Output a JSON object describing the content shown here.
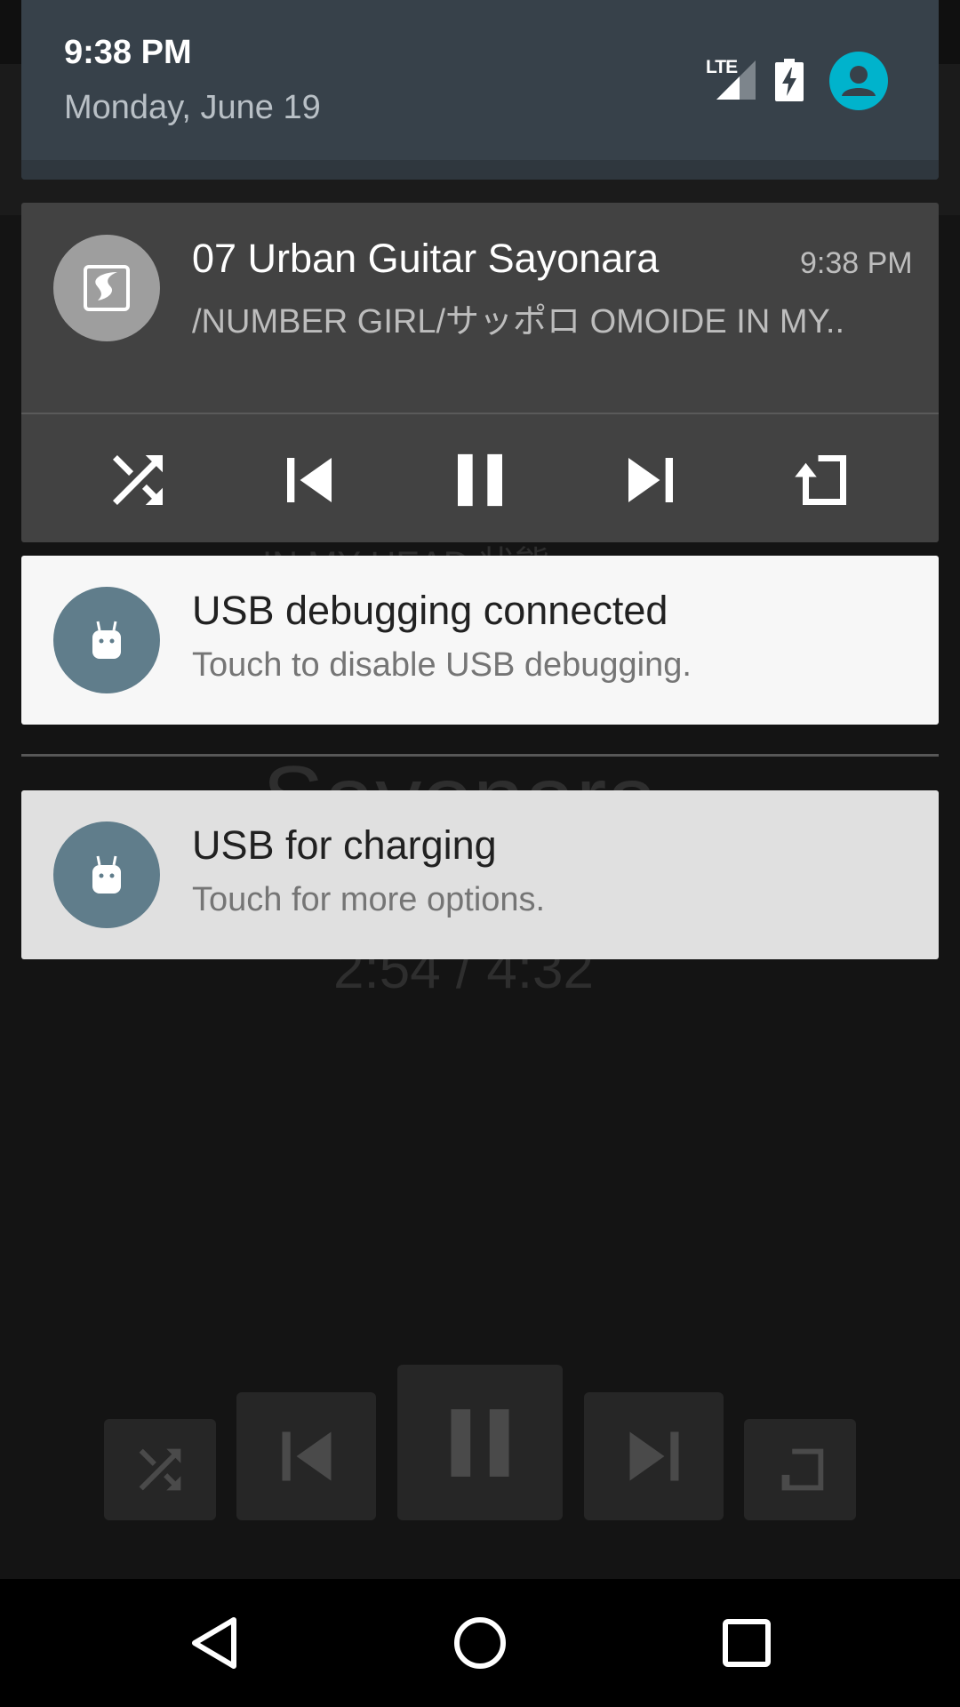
{
  "status": {
    "time": "9:38 PM",
    "date": "Monday, June 19",
    "network_label": "LTE",
    "icons": [
      "signal-icon",
      "battery-charging-icon",
      "user-avatar-icon"
    ],
    "accent_color": "#00b3cc"
  },
  "media": {
    "title": "07 Urban Guitar Sayonara",
    "subtitle": "/NUMBER GIRL/サッポロ OMOIDE IN MY..",
    "time": "9:38 PM",
    "controls": [
      "shuffle-icon",
      "skip-previous-icon",
      "pause-icon",
      "skip-next-icon",
      "repeat-icon"
    ]
  },
  "notifications": [
    {
      "title": "USB debugging connected",
      "text": "Touch to disable USB debugging."
    },
    {
      "title": "USB for charging",
      "text": "Touch for more options."
    }
  ],
  "background_player": {
    "subtitle": "IN MY HEAD 状態",
    "title": "Sayonara",
    "progress": "2:54 / 4:32"
  },
  "navbar": [
    "back-icon",
    "home-icon",
    "recents-icon"
  ]
}
